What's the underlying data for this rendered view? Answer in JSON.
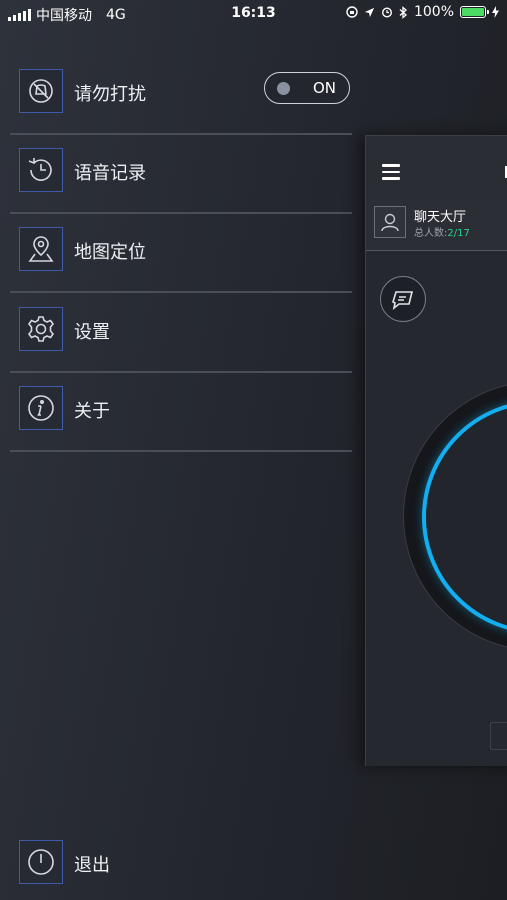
{
  "status_bar": {
    "carrier": "中国移动",
    "network": "4G",
    "time": "16:13",
    "battery_percent": "100%",
    "battery_level": 1.0,
    "icons": [
      "lock-rotation-icon",
      "location-arrow-icon",
      "alarm-icon",
      "bluetooth-icon",
      "charging-bolt-icon"
    ]
  },
  "menu": {
    "items": [
      {
        "label": "请勿打扰",
        "icon": "do-not-disturb-icon"
      },
      {
        "label": "语音记录",
        "icon": "history-clock-icon"
      },
      {
        "label": "地图定位",
        "icon": "map-pin-icon"
      },
      {
        "label": "设置",
        "icon": "gear-icon"
      },
      {
        "label": "关于",
        "icon": "info-icon"
      }
    ],
    "dnd_toggle": {
      "state": "ON",
      "on": true
    },
    "logout_label": "退出",
    "logout_icon": "power-icon"
  },
  "main_panel": {
    "chatroom_title": "聊天大厅",
    "member_count_label": "总人数:",
    "member_count_value": "2/17",
    "accent_color": "#13aef0",
    "count_color": "#2fcf8a"
  }
}
